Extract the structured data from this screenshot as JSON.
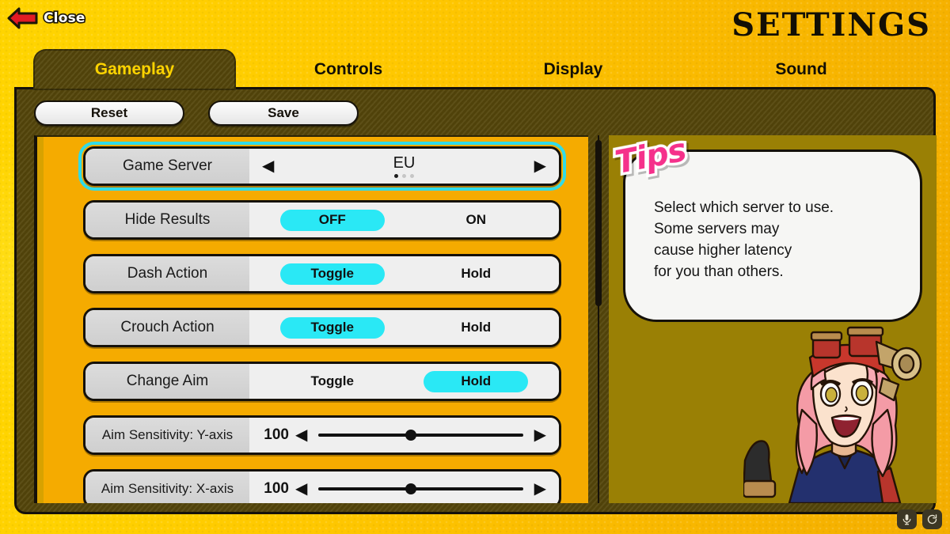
{
  "topbar": {
    "close_label": "Close",
    "close_icon": "back-arrow-icon",
    "title": "SETTINGS"
  },
  "tabs": [
    {
      "label": "Gameplay",
      "active": true
    },
    {
      "label": "Controls",
      "active": false
    },
    {
      "label": "Display",
      "active": false
    },
    {
      "label": "Sound",
      "active": false
    }
  ],
  "actions": {
    "reset_label": "Reset",
    "save_label": "Save"
  },
  "options": [
    {
      "label": "Game Server",
      "type": "stepper",
      "value": "EU",
      "selected": true,
      "left_arrow": "◀",
      "right_arrow": "▶",
      "page_count": 3,
      "page_index": 0
    },
    {
      "label": "Hide Results",
      "type": "choice",
      "choices": [
        "OFF",
        "ON"
      ],
      "selected_index": 0,
      "selected": false
    },
    {
      "label": "Dash Action",
      "type": "choice",
      "choices": [
        "Toggle",
        "Hold"
      ],
      "selected_index": 0,
      "selected": false
    },
    {
      "label": "Crouch Action",
      "type": "choice",
      "choices": [
        "Toggle",
        "Hold"
      ],
      "selected_index": 0,
      "selected": false
    },
    {
      "label": "Change Aim",
      "type": "choice",
      "choices": [
        "Toggle",
        "Hold"
      ],
      "selected_index": 1,
      "selected": false
    },
    {
      "label": "Aim Sensitivity: Y-axis",
      "type": "slider",
      "value": "100",
      "fill_percent": 45,
      "left_arrow": "◀",
      "right_arrow": "▶",
      "selected": false
    },
    {
      "label": "Aim Sensitivity: X-axis",
      "type": "slider",
      "value": "100",
      "fill_percent": 45,
      "left_arrow": "◀",
      "right_arrow": "▶",
      "selected": false
    }
  ],
  "tips": {
    "sticker_label": "Tips",
    "body": "Select which server to use.\nSome servers may\ncause higher latency\nfor you than others."
  },
  "system_icons": [
    {
      "name": "microphone-icon"
    },
    {
      "name": "refresh-icon"
    }
  ],
  "colors": {
    "background_yellow": "#ffd400",
    "panel_dark": "#54460b",
    "tips_panel": "#9a8005",
    "accent_cyan": "#2ae8f5",
    "selection_cyan": "#30dbe8",
    "options_orange": "#f5ab00",
    "sticker_pink": "#f5318b",
    "close_arrow_red": "#e01b24",
    "outline_black": "#15110a"
  }
}
